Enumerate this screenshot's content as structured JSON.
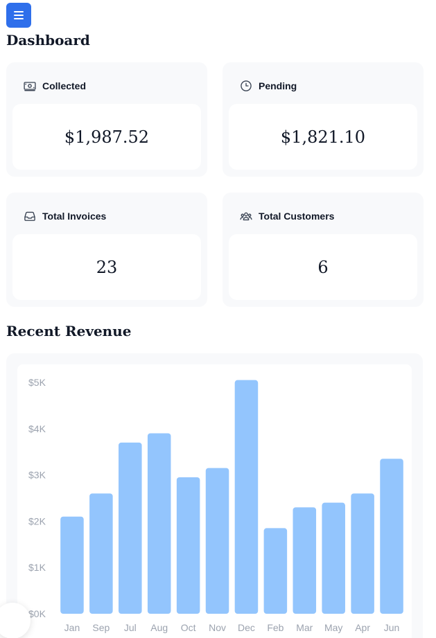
{
  "header": {
    "title": "Dashboard",
    "menu_icon": "hamburger-menu-icon",
    "menu_color": "#2f6feb"
  },
  "cards": [
    {
      "label": "Collected",
      "value": "$1,987.52",
      "icon": "banknote-icon"
    },
    {
      "label": "Pending",
      "value": "$1,821.10",
      "icon": "clock-icon"
    },
    {
      "label": "Total Invoices",
      "value": "23",
      "icon": "inbox-icon"
    },
    {
      "label": "Total Customers",
      "value": "6",
      "icon": "users-icon"
    }
  ],
  "revenue": {
    "title": "Recent Revenue"
  },
  "chart_data": {
    "type": "bar",
    "categories": [
      "Jan",
      "Sep",
      "Jul",
      "Aug",
      "Oct",
      "Nov",
      "Dec",
      "Feb",
      "Mar",
      "May",
      "Apr",
      "Jun"
    ],
    "values": [
      2100,
      2600,
      3700,
      3900,
      2950,
      3150,
      5050,
      1850,
      2300,
      2400,
      2600,
      3350
    ],
    "y_ticks": [
      "$0K",
      "$1K",
      "$2K",
      "$3K",
      "$4K",
      "$5K"
    ],
    "ylim": [
      0,
      5000
    ],
    "bar_color": "#93c5fd",
    "grid": false,
    "title": "",
    "xlabel": "",
    "ylabel": ""
  }
}
